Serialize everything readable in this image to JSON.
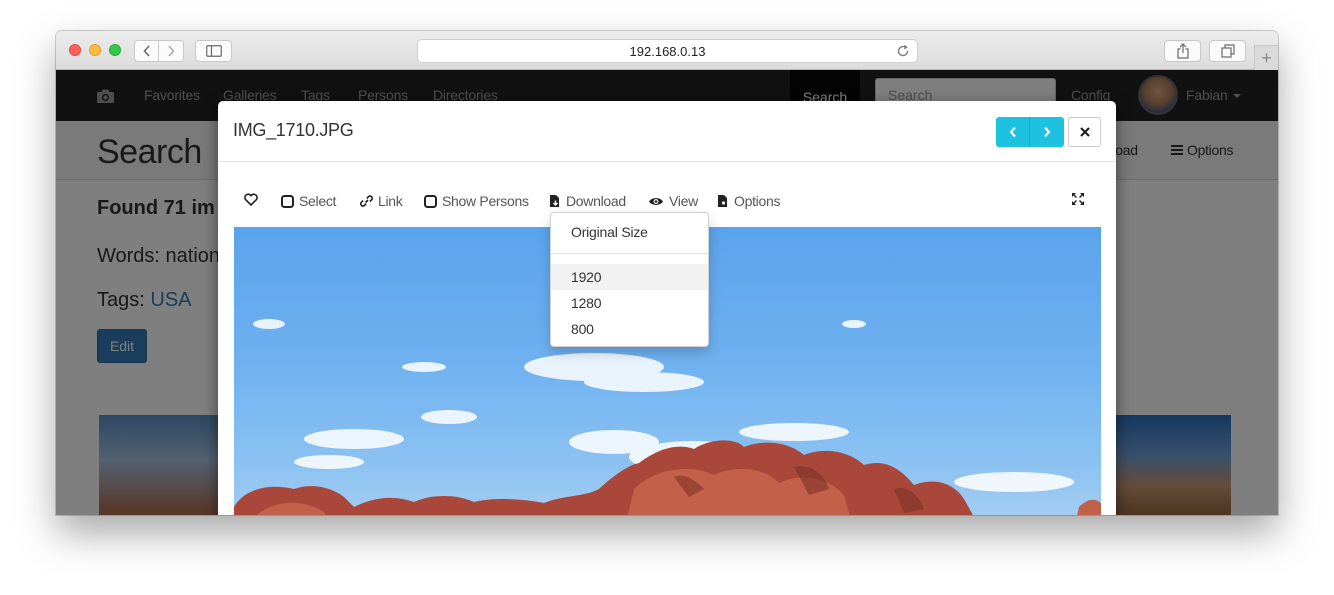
{
  "browser": {
    "url": "192.168.0.13",
    "icons": {
      "back": "chevron-left-icon",
      "forward": "chevron-right-icon",
      "sidebar": "sidebar-icon",
      "reload": "reload-icon",
      "share": "share-icon",
      "tabs": "tabs-icon",
      "new_tab": "plus-icon"
    },
    "new_tab_label": "+"
  },
  "navbar": {
    "items": [
      "Favorites",
      "Galleries",
      "Tags",
      "Persons",
      "Directories"
    ],
    "search_tab": "Search",
    "search_placeholder": "Search",
    "config": "Config",
    "user": "Fabian",
    "camera_icon": "camera-icon"
  },
  "page": {
    "title": "Search",
    "actions": {
      "download": "nload",
      "options": "Options"
    },
    "found": "Found 71 im",
    "words_label": "Words: nationa",
    "tags_label": "Tags:",
    "tag": "USA",
    "edit": "Edit"
  },
  "modal": {
    "title": "IMG_1710.JPG",
    "toolbar": {
      "select": "Select",
      "link": "Link",
      "show_persons": "Show Persons",
      "download": "Download",
      "view": "View",
      "options": "Options"
    },
    "accent_color": "#1dc2e1",
    "download_menu": {
      "items": [
        "Original Size",
        "1920",
        "1280",
        "800"
      ],
      "highlighted": "1920"
    }
  }
}
